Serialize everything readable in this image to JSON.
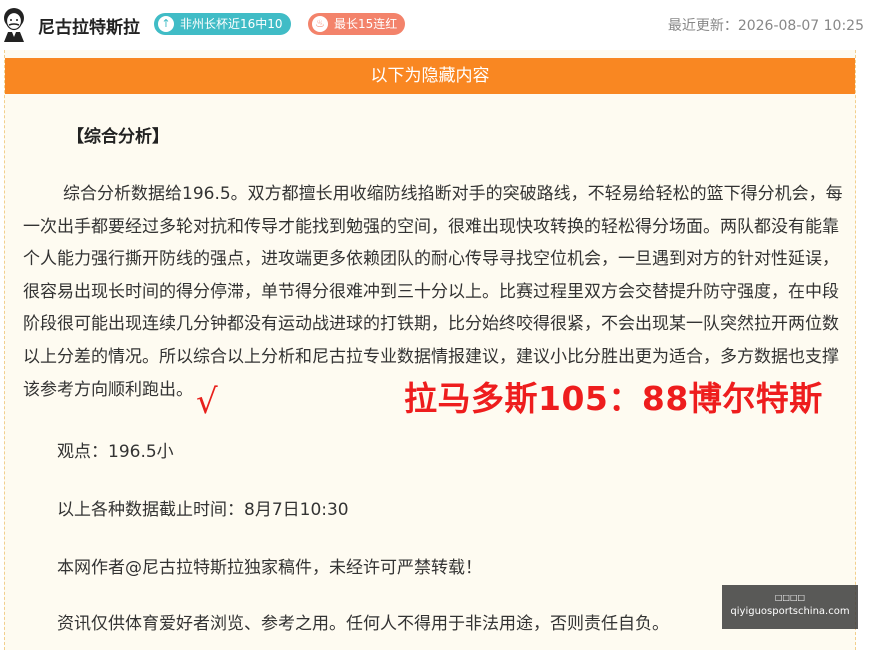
{
  "header": {
    "author": "尼古拉特斯拉",
    "badges": [
      {
        "icon": "up-arrow-icon",
        "label": "非州长杯近16中10",
        "color": "#40bcc6"
      },
      {
        "icon": "flame-icon",
        "label": "最长15连红",
        "color": "#f3836b"
      }
    ],
    "updated_label": "最近更新：2026-08-07 10:25"
  },
  "content": {
    "banner": "以下为隐藏内容",
    "section_title": "【综合分析】",
    "paragraph": "综合分析数据给196.5。双方都擅长用收缩防线掐断对手的突破路线，不轻易给轻松的篮下得分机会，每一次出手都要经过多轮对抗和传导才能找到勉强的空间，很难出现快攻转换的轻松得分场面。两队都没有能靠个人能力强行撕开防线的强点，进攻端更多依赖团队的耐心传导寻找空位机会，一旦遇到对方的针对性延误，很容易出现长时间的得分停滞，单节得分很难冲到三十分以上。比赛过程里双方会交替提升防守强度，在中段阶段很可能出现连续几分钟都没有运动战进球的打铁期，比分始终咬得很紧，不会出现某一队突然拉开两位数以上分差的情况。所以综合以上分析和尼古拉专业数据情报建议，建议小比分胜出更为适合，多方数据也支撑该参考方向顺利跑出。",
    "viewpoint": "观点：196.5小",
    "checkmark": "√",
    "result": "拉马多斯105：88博尔特斯",
    "cutoff": "以上各种数据截止时间：8月7日10:30",
    "copyright": "本网作者@尼古拉特斯拉独家稿件，未经许可严禁转载！",
    "disclaimer": "资讯仅供体育爱好者浏览、参考之用。任何人不得用于非法用途，否则责任自负。"
  },
  "watermark": {
    "line1": "□□□□",
    "line2": "qiyiguosportschina.com"
  },
  "colors": {
    "accent": "#f98722",
    "result": "#ee1d1d",
    "card_bg": "#fefbf1"
  }
}
